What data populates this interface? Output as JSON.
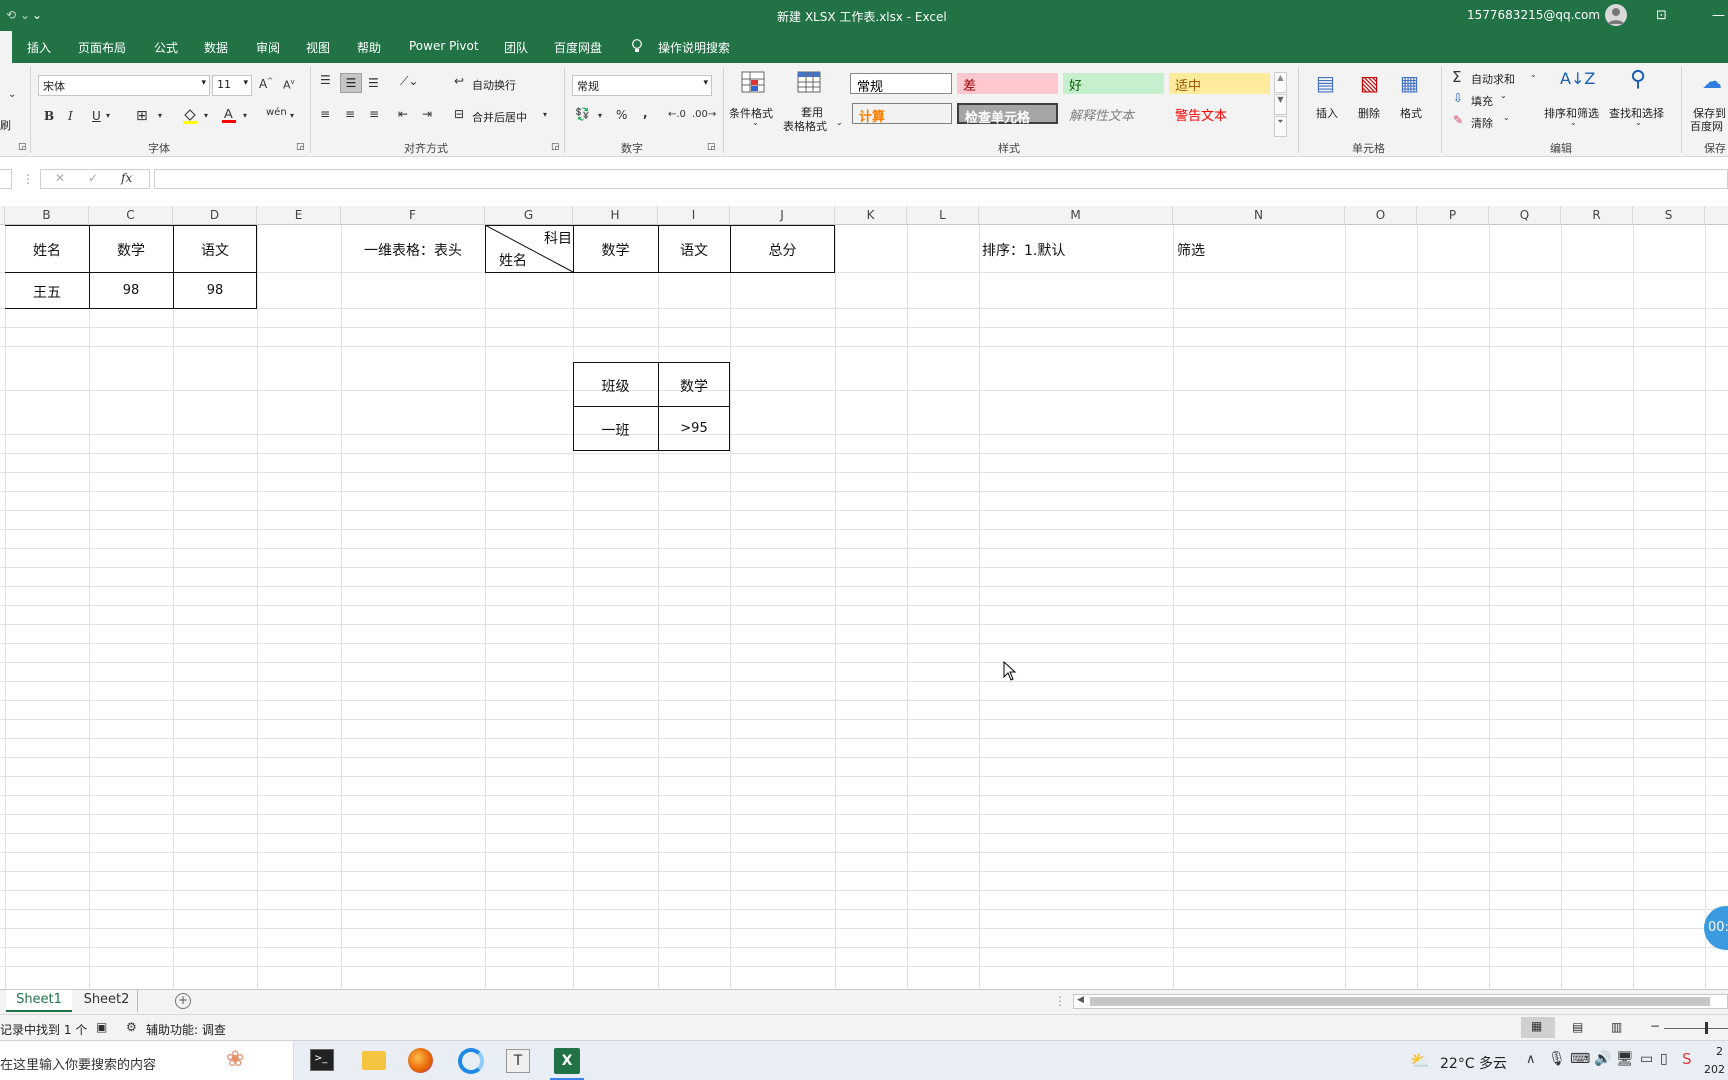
{
  "title_bar": {
    "quick_access": "☰",
    "doc_title": "新建 XLSX 工作表.xlsx  -  Excel",
    "account": "1577683215@qq.com"
  },
  "ribbon_tabs": [
    "插入",
    "页面布局",
    "公式",
    "数据",
    "审阅",
    "视图",
    "帮助",
    "Power Pivot",
    "团队",
    "百度网盘",
    "操作说明搜索"
  ],
  "ribbon": {
    "clipboard_partial": "刷",
    "font_name": "宋体",
    "font_size": "11",
    "font_group": "字体",
    "wrap_text": "自动换行",
    "merge_center": "合并后居中",
    "align_group": "对齐方式",
    "number_format": "常规",
    "number_group": "数字",
    "cond_format": "条件格式",
    "table_format_1": "套用",
    "table_format_2": "表格格式",
    "styles": {
      "normal": "常规",
      "bad": "差",
      "good": "好",
      "neutral": "适中",
      "calc": "计算",
      "check": "检查单元格",
      "explain": "解释性文本",
      "warn": "警告文本"
    },
    "styles_group": "样式",
    "insert": "插入",
    "delete": "删除",
    "format": "格式",
    "cells_group": "单元格",
    "autosum": "自动求和",
    "fill": "填充",
    "clear": "清除",
    "sort_filter": "排序和筛选",
    "find_select": "查找和选择",
    "edit_group": "编辑",
    "save_baidu_1": "保存到",
    "save_baidu_2": "百度网",
    "save_group": "保存"
  },
  "formula_bar": {
    "fx": "fx",
    "value": ""
  },
  "columns": [
    "B",
    "C",
    "D",
    "E",
    "F",
    "G",
    "H",
    "I",
    "J",
    "K",
    "L",
    "M",
    "N",
    "O",
    "P",
    "Q",
    "R",
    "S"
  ],
  "cells": {
    "b1": "姓名",
    "c1": "数学",
    "d1": "语文",
    "b2": "王五",
    "c2": "98",
    "d2": "98",
    "f1": "一维表格：表头",
    "g1_top": "科目",
    "g1_bottom": "姓名",
    "h1": "数学",
    "i1": "语文",
    "j1": "总分",
    "m1": "排序：1.默认",
    "n1": "筛选",
    "h4": "班级",
    "i4": "数学",
    "h5": "一班",
    "i5": ">95"
  },
  "timer_bubble": "00:",
  "sheets": [
    "Sheet1",
    "Sheet2"
  ],
  "status": {
    "found": "记录中找到 1 个",
    "accessibility": "辅助功能: 调查"
  },
  "taskbar": {
    "search_placeholder": "在这里输入你要搜索的内容",
    "weather": "22°C  多云",
    "time": "2",
    "date": "202"
  },
  "colors": {
    "excel_green": "#217346",
    "bad_bg": "#ffc7ce",
    "bad_fg": "#9c0006",
    "good_bg": "#c6efce",
    "good_fg": "#006100",
    "neutral_bg": "#ffeb9c",
    "neutral_fg": "#9c5700",
    "check_bg": "#a5a5a5",
    "calc_fg": "#fa7d00"
  }
}
